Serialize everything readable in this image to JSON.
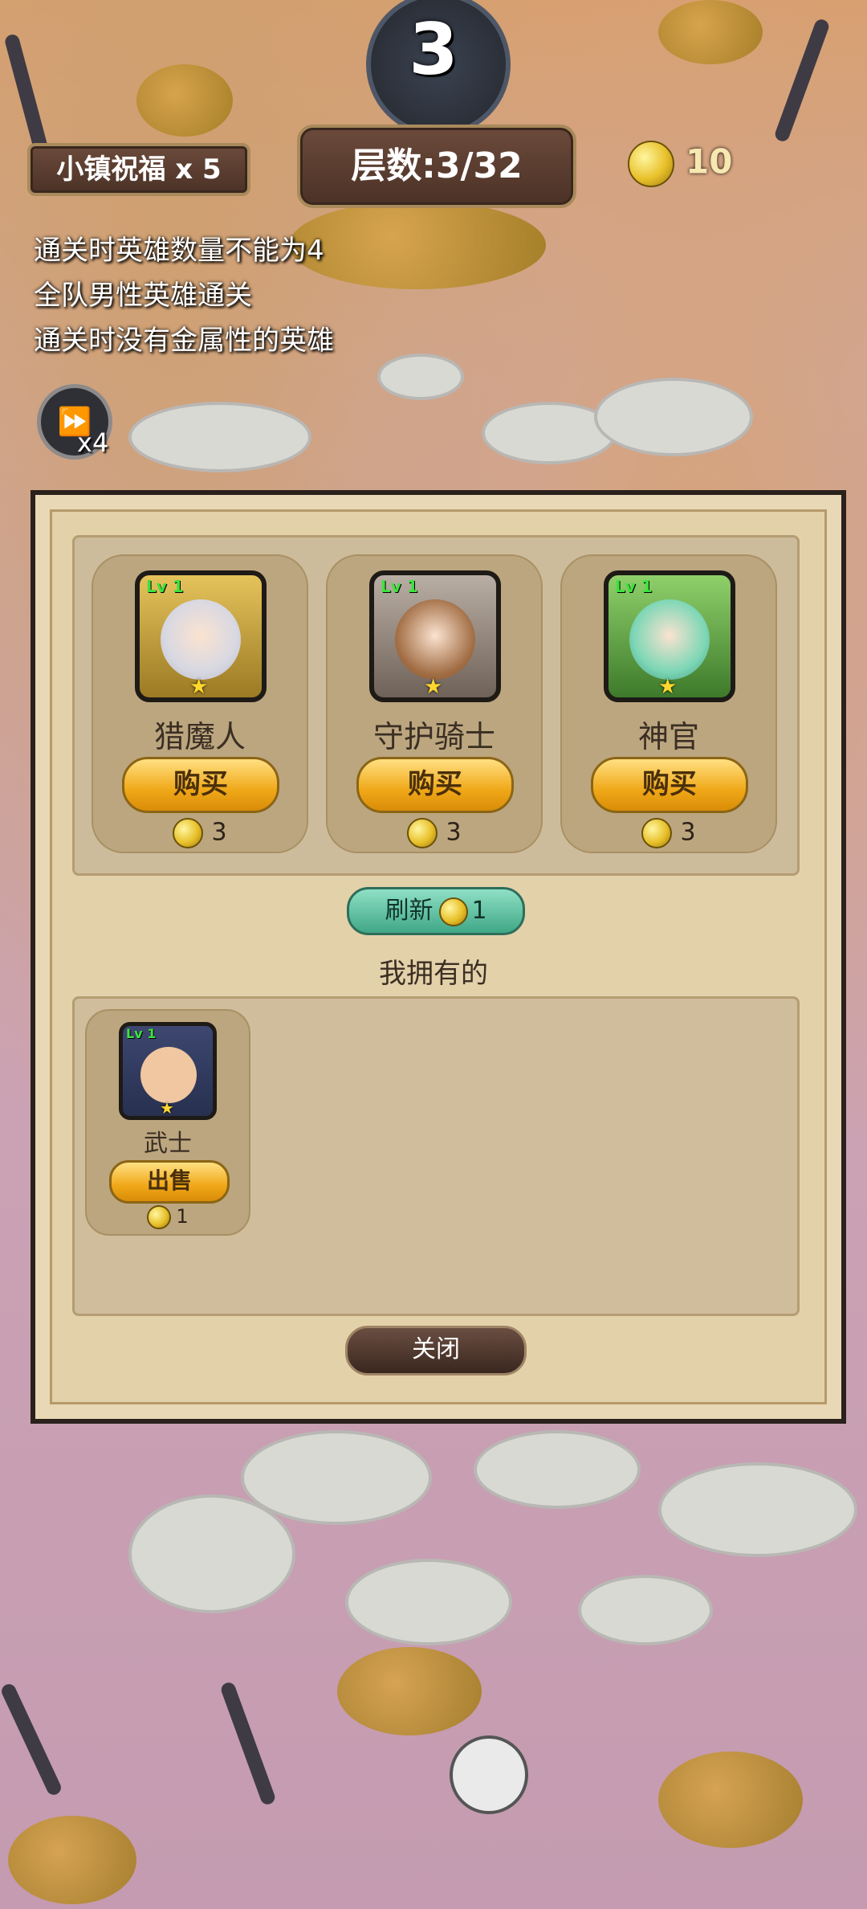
{
  "hud": {
    "wave_number": "3",
    "blessing": "小镇祝福 x 5",
    "floor": "层数:3/32",
    "gold": "10",
    "speed_icon": "fast-forward-icon",
    "speed_multiplier": "x4"
  },
  "conditions": [
    "通关时英雄数量不能为4",
    "全队男性英雄通关",
    "通关时没有金属性的英雄"
  ],
  "shop": {
    "heroes": [
      {
        "name": "猎魔人",
        "level": "Lv 1",
        "buy_label": "购买",
        "price": "3",
        "frame_color": "#caa23a"
      },
      {
        "name": "守护骑士",
        "level": "Lv 1",
        "buy_label": "购买",
        "price": "3",
        "frame_color": "#9a8f86"
      },
      {
        "name": "神官",
        "level": "Lv 1",
        "buy_label": "购买",
        "price": "3",
        "frame_color": "#5aa24a"
      }
    ],
    "refresh_label": "刷新",
    "refresh_cost": "1",
    "owned_title": "我拥有的",
    "owned": [
      {
        "name": "武士",
        "level": "Lv 1",
        "sell_label": "出售",
        "price": "1"
      }
    ],
    "close_label": "关闭"
  }
}
